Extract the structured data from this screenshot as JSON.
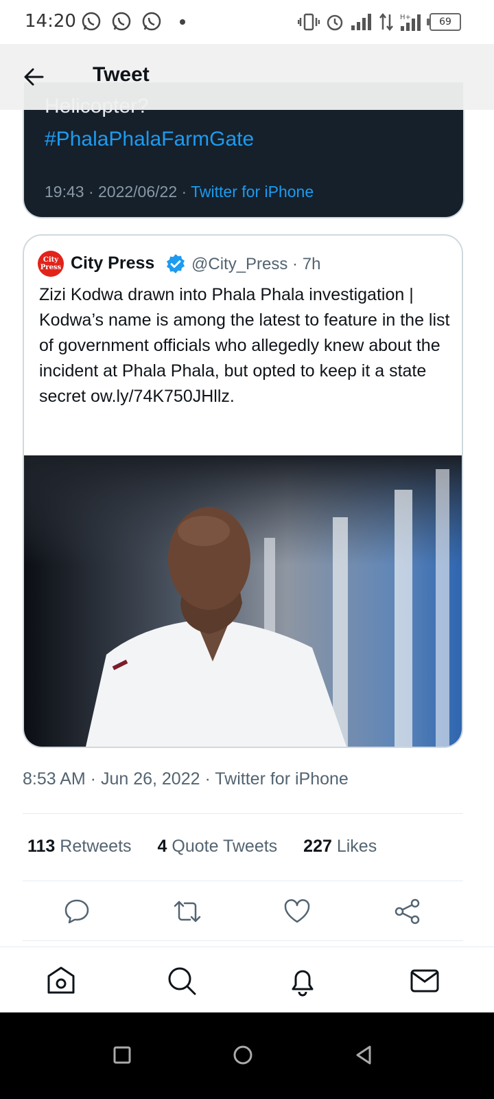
{
  "status_bar": {
    "time": "14:20",
    "battery": "69",
    "icons": [
      "whatsapp-icon",
      "whatsapp-icon",
      "whatsapp-icon",
      "vibrate-icon",
      "alarm-icon",
      "signal-icon",
      "data-arrows-icon",
      "h-plus-signal-icon",
      "battery-icon"
    ]
  },
  "header": {
    "title": "Tweet"
  },
  "previous_tweet": {
    "cut_text": "Helicopter?",
    "hashtag": "#PhalaPhalaFarmGate",
    "meta_time": "19:43 · 2022/06/22 · ",
    "meta_source": "Twitter for iPhone"
  },
  "quoted_tweet": {
    "avatar_text": "City Press",
    "name": "City Press",
    "handle_time": "@City_Press · 7h",
    "text": "Zizi Kodwa drawn into Phala Phala investigation | Kodwa’s name is among the latest to feature in the list of government officials who allegedly knew about the incident at Phala Phala, but opted to keep it a state secret ow.ly/74K750JHllz."
  },
  "tweet_meta": {
    "timestamp": "8:53 AM · Jun 26, 2022 · Twitter for iPhone"
  },
  "stats": {
    "retweets_count": "113",
    "retweets_label": "Retweets",
    "quotes_count": "4",
    "quotes_label": "Quote Tweets",
    "likes_count": "227",
    "likes_label": "Likes"
  },
  "actions": [
    "reply-icon",
    "retweet-icon",
    "like-icon",
    "share-icon"
  ],
  "bottom_nav": [
    "home-icon",
    "search-icon",
    "notifications-icon",
    "messages-icon"
  ],
  "system_nav": [
    "recents-button",
    "home-button",
    "back-button"
  ],
  "colors": {
    "accent": "#1d9bf0",
    "dark_card": "#15202b",
    "text_secondary": "#536471",
    "brand_red": "#e2231a"
  }
}
